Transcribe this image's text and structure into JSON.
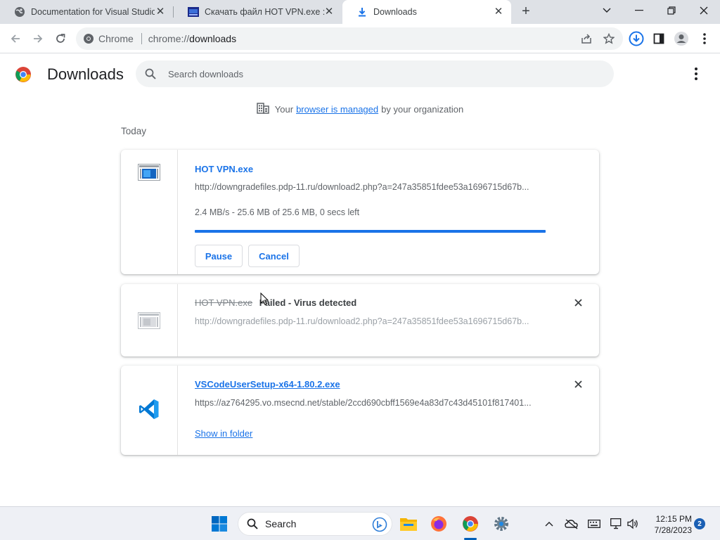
{
  "tabs": [
    {
      "title": "Documentation for Visual Studio",
      "icon": "globe-icon",
      "active": false
    },
    {
      "title": "Скачать файл HOT VPN.exe :: Фа",
      "icon": "site-favicon-icon",
      "active": false
    },
    {
      "title": "Downloads",
      "icon": "download-icon",
      "active": true
    }
  ],
  "toolbar": {
    "site_chip": "Chrome",
    "url_scheme": "chrome://",
    "url_host": "downloads"
  },
  "downloads_page": {
    "title": "Downloads",
    "search_placeholder": "Search downloads",
    "managed_prefix": "Your",
    "managed_link": "browser is managed",
    "managed_suffix": "by your organization",
    "section_label": "Today"
  },
  "downloads": [
    {
      "name": "HOT VPN.exe",
      "url": "http://downgradefiles.pdp-11.ru/download2.php?a=247a35851fdee53a1696715d67b...",
      "status": "2.4 MB/s - 25.6 MB of 25.6 MB, 0 secs left",
      "progress": 1.0,
      "pause_label": "Pause",
      "cancel_label": "Cancel"
    },
    {
      "name": "HOT VPN.exe",
      "failed_text": "Failed - Virus detected",
      "url": "http://downgradefiles.pdp-11.ru/download2.php?a=247a35851fdee53a1696715d67b..."
    },
    {
      "name": "VSCodeUserSetup-x64-1.80.2.exe",
      "url": "https://az764295.vo.msecnd.net/stable/2ccd690cbff1569e4a83d7c43d45101f817401...",
      "show_in_folder": "Show in folder"
    }
  ],
  "taskbar": {
    "search_label": "Search",
    "time": "12:15 PM",
    "date": "7/28/2023",
    "notification_count": "2"
  },
  "colors": {
    "accent": "#1a73e8",
    "tabstrip": "#dee1e6",
    "omnibox": "#f1f3f4",
    "taskbar": "#eef0f5"
  }
}
